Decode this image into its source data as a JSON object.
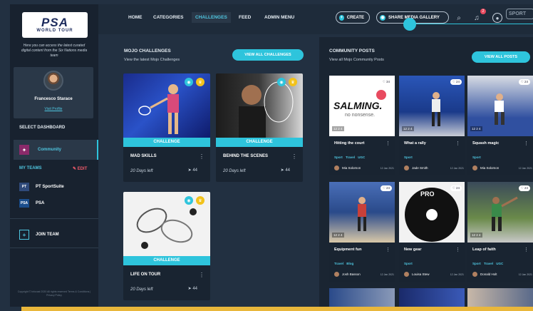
{
  "brand": {
    "logo_main": "PSA",
    "logo_sub": "WORLD TOUR",
    "description": "Here you can access the latest curated digital content from the Six Nations media team"
  },
  "profile": {
    "name": "Francesco Starace",
    "link": "Visit Profile"
  },
  "sidebar": {
    "select_dashboard": "SELECT DASHBOARD",
    "dashboard_item": "Community",
    "my_teams": "MY TEAMS",
    "edit": "EDIT",
    "teams": [
      {
        "label": "PT SportSuite",
        "icon": "PT"
      },
      {
        "label": "PSA",
        "icon": "PSA"
      }
    ],
    "join_team": "JOIN TEAM",
    "copyright": "Copyright © Infocast 2020 All rights reserved Terms & Conditions | Privacy Policy"
  },
  "nav": {
    "items": [
      "HOME",
      "CATEGORIES",
      "CHALLENGES",
      "FEED",
      "ADMIN MENU"
    ],
    "active": "CHALLENGES",
    "create": "CREATE",
    "share": "SHARE MEDIA GALLERY",
    "notif_count": "2",
    "sport_label": "SPORT"
  },
  "mojo": {
    "title": "MOJO CHALLENGES",
    "subtitle": "View the latest Mojo Challenges",
    "view_all": "VIEW ALL CHALLENGES",
    "cards": [
      {
        "band": "CHALLENGE",
        "title": "MAD SKILLS",
        "days": "20 Days left",
        "shares": "44"
      },
      {
        "band": "CHALLENGE",
        "title": "BEHIND THE SCENES",
        "days": "20 Days left",
        "shares": "44"
      },
      {
        "band": "CHALLENGE",
        "title": "LIFE ON TOUR",
        "days": "20 Days left",
        "shares": "44"
      }
    ]
  },
  "community": {
    "title": "COMMUNITY POSTS",
    "subtitle": "View all Mojo Community Posts",
    "view_all": "VIEW ALL POSTS",
    "posts": [
      {
        "title": "Hitting the court",
        "tags": "Sport Travel UGC",
        "author": "Mia Solomon",
        "date": "12 Jan 2021",
        "likes": "34",
        "stats": "12  2  4"
      },
      {
        "title": "What a rally",
        "tags": "Sport",
        "author": "Jade Smith",
        "date": "12 Jan 2021",
        "likes": "24",
        "stats": "12  2  4"
      },
      {
        "title": "Squash magic",
        "tags": "Sport",
        "author": "Mia Solomon",
        "date": "12 Jan 2021",
        "likes": "24",
        "stats": "12  2  4"
      },
      {
        "title": "Equipment fun",
        "tags": "Travel Blog",
        "author": "Josh Basson",
        "date": "12 Jan 2021",
        "likes": "24",
        "stats": "12  2  4"
      },
      {
        "title": "New gear",
        "tags": "Sport",
        "author": "Louisa Stew",
        "date": "12 Jan 2021",
        "likes": "24",
        "stats": "12  2  4"
      },
      {
        "title": "Leap of faith",
        "tags": "Sport Travel UGC",
        "author": "Donald Holt",
        "date": "12 Jan 2021",
        "likes": "24",
        "stats": "12  2  4"
      }
    ],
    "salming": "SALMING.",
    "salming_sub": "no nonsense."
  },
  "colors": {
    "accent": "#2ec4dc",
    "sidebar": "#18222f",
    "panel": "#223041",
    "gold": "#f2c21b"
  }
}
